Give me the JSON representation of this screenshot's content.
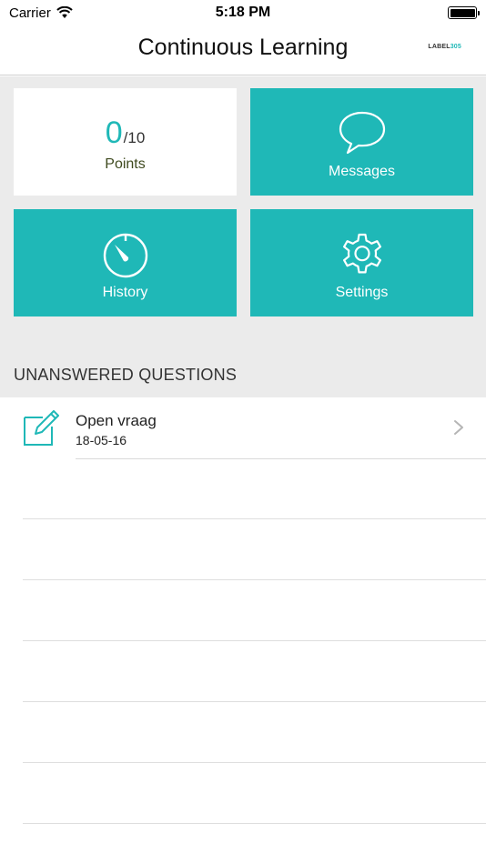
{
  "status_bar": {
    "carrier": "Carrier",
    "time": "5:18 PM",
    "wifi_icon": "wifi-icon",
    "battery_icon": "battery-icon"
  },
  "nav": {
    "title": "Continuous Learning",
    "brand_prefix": "LABEL",
    "brand_suffix": "305"
  },
  "tiles": {
    "points": {
      "value": "0",
      "max": "/10",
      "label": "Points"
    },
    "messages": {
      "label": "Messages",
      "icon": "speech-bubble-icon"
    },
    "history": {
      "label": "History",
      "icon": "stopwatch-icon"
    },
    "settings": {
      "label": "Settings",
      "icon": "gear-icon"
    }
  },
  "section": {
    "title": "UNANSWERED QUESTIONS"
  },
  "questions": [
    {
      "title": "Open vraag",
      "date": "18-05-16",
      "icon": "edit-icon"
    }
  ],
  "colors": {
    "accent": "#1fb8b7",
    "background": "#ebebeb"
  }
}
